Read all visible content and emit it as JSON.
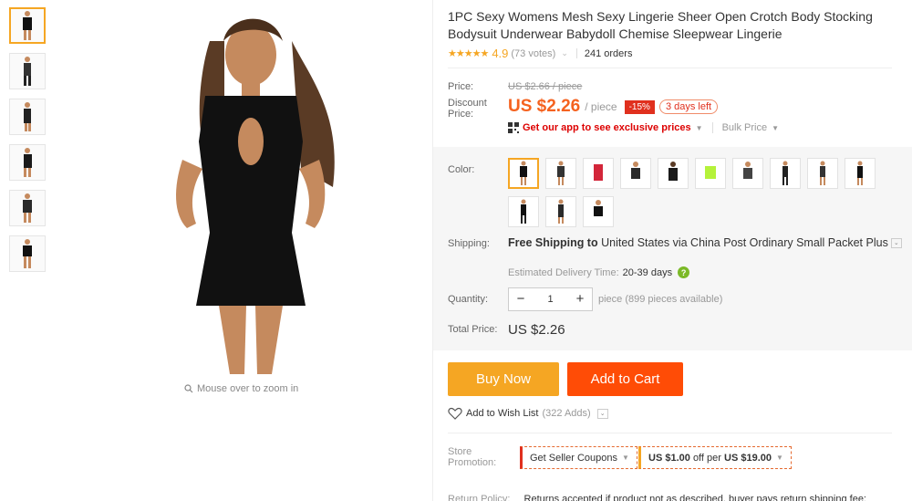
{
  "gallery": {
    "thumbnail_count": 6,
    "zoom_hint": "Mouse over to zoom in"
  },
  "product": {
    "title": "1PC Sexy Womens Mesh Sexy Lingerie Sheer Open Crotch Body Stocking Bodysuit Underwear Babydoll Chemise Sleepwear Lingerie",
    "stars": "★★★★★",
    "rating": "4.9",
    "votes": "(73 votes)",
    "orders": "241 orders"
  },
  "price": {
    "price_label": "Price:",
    "old_price": "US $2.66 / piece",
    "discount_label_1": "Discount",
    "discount_label_2": "Price:",
    "new_price": "US $2.26",
    "per": "/ piece",
    "discount_badge": "-15%",
    "days_left": "3 days left",
    "app_promo": "Get our app to see exclusive prices",
    "bulk_price": "Bulk Price"
  },
  "options": {
    "color_label": "Color:",
    "swatch_count": 13,
    "shipping_label": "Shipping:",
    "shipping_free": "Free Shipping to",
    "shipping_rest": "United States via China Post Ordinary Small Packet Plus",
    "est_label": "Estimated Delivery Time:",
    "est_value": "20-39 days",
    "help": "?",
    "quantity_label": "Quantity:",
    "minus": "−",
    "quantity": "1",
    "plus": "+",
    "available": "piece (899 pieces available)",
    "total_label": "Total Price:",
    "total": "US $2.26"
  },
  "actions": {
    "buy_now": "Buy Now",
    "add_to_cart": "Add to Cart",
    "wishlist": "Add to Wish List",
    "wishlist_count": "(322 Adds)"
  },
  "promotion": {
    "label_1": "Store",
    "label_2": "Promotion:",
    "seller_coupons": "Get Seller Coupons",
    "coupon_off": "US $1.00",
    "coupon_mid": "off per",
    "coupon_min": "US $19.00"
  },
  "return_policy": {
    "label": "Return Policy:",
    "text": "Returns accepted if product not as described, buyer pays return shipping fee;"
  },
  "colors": {
    "accent": "#f5a623",
    "price": "#f5621f",
    "cart": "#ff4c06",
    "badge": "#e0301e",
    "link": "#dd0000"
  }
}
